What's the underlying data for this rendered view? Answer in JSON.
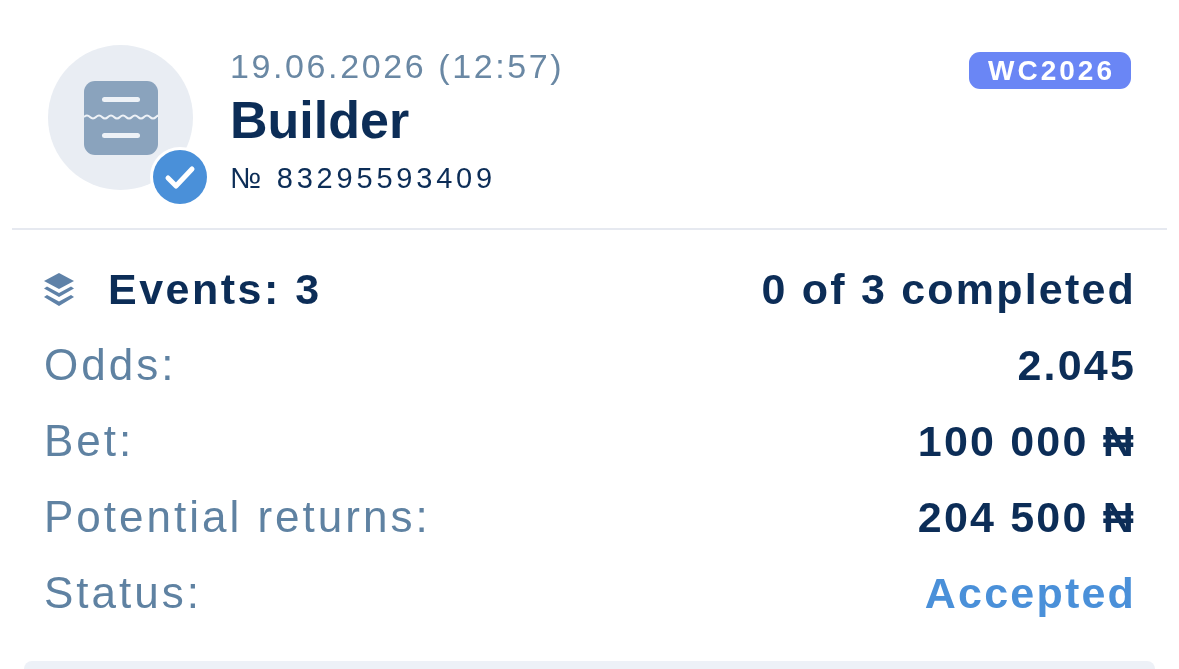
{
  "bet": {
    "date": "19.06.2026 (12:57)",
    "type": "Builder",
    "number": "№ 83295593409",
    "verified": true,
    "tag": "WC2026"
  },
  "summary": {
    "events": "Events: 3",
    "completed_text": "0 of 3 completed"
  },
  "details": [
    {
      "label": "Odds:",
      "value": "2.045",
      "kind": "amount"
    },
    {
      "label": "Bet:",
      "value": "100 000 ₦",
      "kind": "amount"
    },
    {
      "label": "Potential returns:",
      "value": "204 500 ₦",
      "kind": "amount"
    },
    {
      "label": "Status:",
      "value": "Accepted",
      "kind": "status"
    }
  ]
}
